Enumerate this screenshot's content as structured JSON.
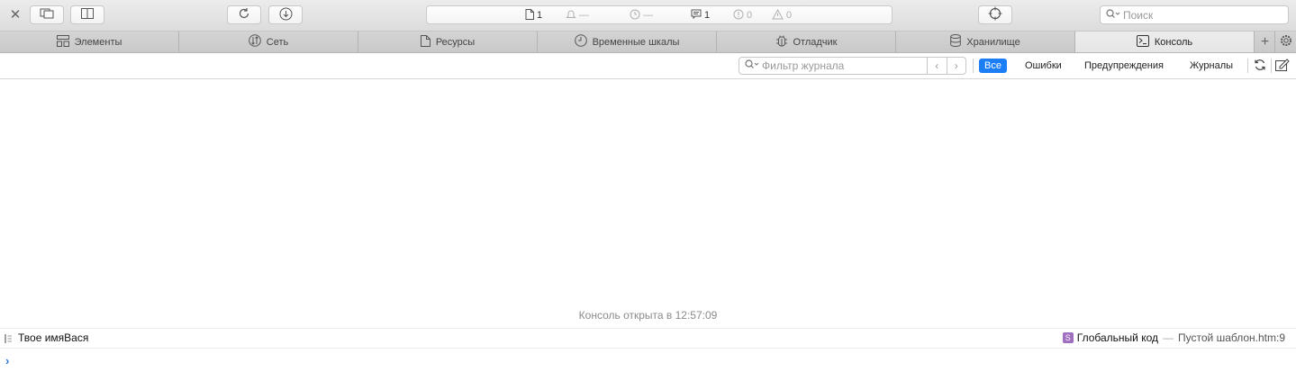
{
  "toolbar": {
    "activity": {
      "resources": "1",
      "timeline": "—",
      "load_time": "—",
      "logs": "1",
      "errors": "0",
      "warnings": "0"
    },
    "search": {
      "placeholder": "Поиск",
      "value": ""
    }
  },
  "tabs": [
    {
      "label": "Элементы",
      "icon": "elements-icon"
    },
    {
      "label": "Сеть",
      "icon": "network-icon"
    },
    {
      "label": "Ресурсы",
      "icon": "resources-icon"
    },
    {
      "label": "Временные шкалы",
      "icon": "timeline-icon"
    },
    {
      "label": "Отладчик",
      "icon": "debugger-icon"
    },
    {
      "label": "Хранилище",
      "icon": "storage-icon"
    },
    {
      "label": "Консоль",
      "icon": "console-icon",
      "active": true
    }
  ],
  "filter": {
    "placeholder": "Фильтр журнала",
    "value": "",
    "levels": [
      "Все",
      "Ошибки",
      "Предупреждения",
      "Журналы"
    ],
    "active_level": "Все"
  },
  "console": {
    "session_start": "Консоль открыта в 12:57:09",
    "messages": [
      {
        "text": "Твое имяВася",
        "source_badge": "S",
        "source_function": "Глобальный код",
        "source_separator": "—",
        "source_location": "Пустой шаблон.htm:9"
      }
    ],
    "prompt_value": ""
  },
  "colors": {
    "accent": "#1b7ef6",
    "source_badge": "#a06fbf",
    "prompt": "#2d76db"
  }
}
